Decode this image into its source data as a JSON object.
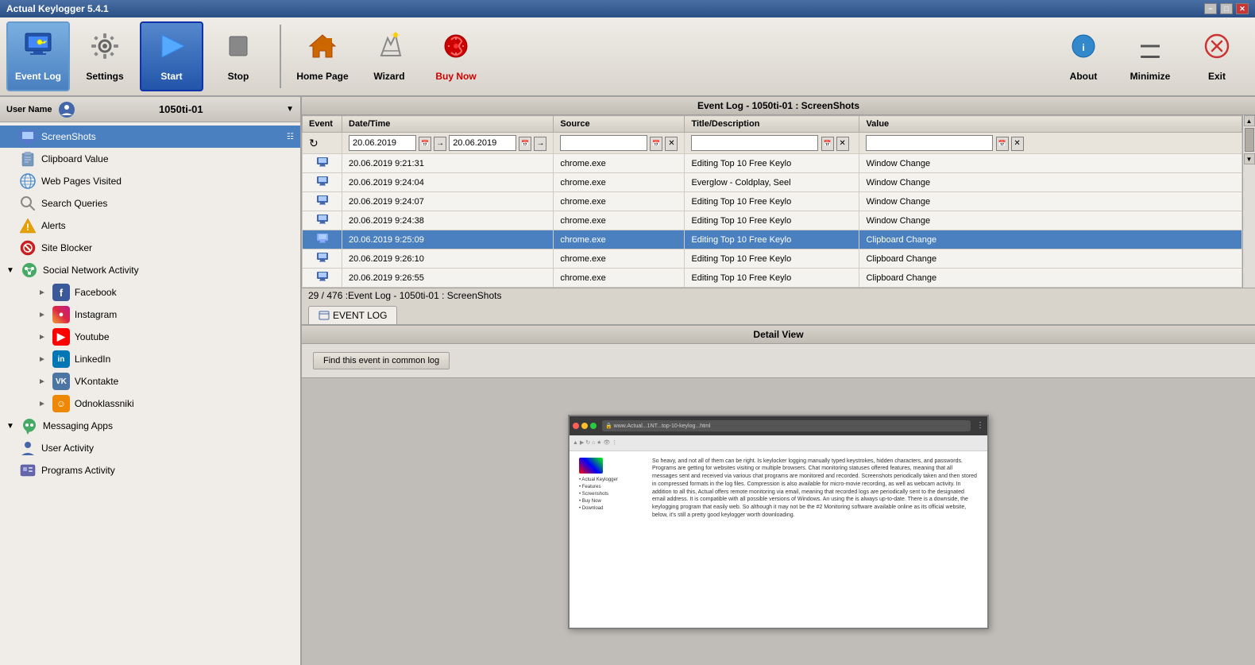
{
  "app": {
    "title": "Actual Keylogger 5.4.1",
    "title_buttons": [
      "minimize",
      "maximize",
      "close"
    ]
  },
  "toolbar": {
    "event_log_label": "Event Log",
    "settings_label": "Settings",
    "start_label": "Start",
    "stop_label": "Stop",
    "home_page_label": "Home Page",
    "wizard_label": "Wizard",
    "buy_now_label": "Buy Now",
    "about_label": "About",
    "minimize_label": "Minimize",
    "exit_label": "Exit"
  },
  "sidebar": {
    "user_label": "User Name",
    "username": "1050ti-01",
    "items": [
      {
        "id": "screenshots",
        "label": "ScreenShots",
        "indent": 1,
        "icon": "monitor",
        "selected": true
      },
      {
        "id": "clipboard",
        "label": "Clipboard Value",
        "indent": 1,
        "icon": "clipboard",
        "selected": false
      },
      {
        "id": "web-pages",
        "label": "Web Pages Visited",
        "indent": 1,
        "icon": "globe",
        "selected": false
      },
      {
        "id": "search",
        "label": "Search Queries",
        "indent": 1,
        "icon": "search",
        "selected": false
      },
      {
        "id": "alerts",
        "label": "Alerts",
        "indent": 1,
        "icon": "alert",
        "selected": false
      },
      {
        "id": "site-blocker",
        "label": "Site Blocker",
        "indent": 1,
        "icon": "block",
        "selected": false
      },
      {
        "id": "social",
        "label": "Social Network Activity",
        "indent": 0,
        "icon": "social",
        "selected": false,
        "expandable": true
      },
      {
        "id": "facebook",
        "label": "Facebook",
        "indent": 2,
        "icon": "fb",
        "selected": false,
        "expandable": true
      },
      {
        "id": "instagram",
        "label": "Instagram",
        "indent": 2,
        "icon": "ig",
        "selected": false,
        "expandable": true
      },
      {
        "id": "youtube",
        "label": "Youtube",
        "indent": 2,
        "icon": "yt",
        "selected": false,
        "expandable": true
      },
      {
        "id": "linkedin",
        "label": "LinkedIn",
        "indent": 2,
        "icon": "li",
        "selected": false,
        "expandable": true
      },
      {
        "id": "vkontakte",
        "label": "VKontakte",
        "indent": 2,
        "icon": "vk",
        "selected": false,
        "expandable": true
      },
      {
        "id": "odnoklassniki",
        "label": "Odnoklassniki",
        "indent": 2,
        "icon": "ok",
        "selected": false,
        "expandable": true
      },
      {
        "id": "messaging",
        "label": "Messaging Apps",
        "indent": 0,
        "icon": "messaging",
        "selected": false,
        "expandable": true
      },
      {
        "id": "user-activity",
        "label": "User Activity",
        "indent": 1,
        "icon": "user",
        "selected": false
      },
      {
        "id": "programs",
        "label": "Programs Activity",
        "indent": 1,
        "icon": "programs",
        "selected": false
      }
    ]
  },
  "event_log": {
    "panel_title": "Event Log - 1050ti-01 : ScreenShots",
    "columns": [
      "Event",
      "Date/Time",
      "Source",
      "Title/Description",
      "Value"
    ],
    "date_from": "20.06.2019",
    "date_to": "20.06.2019",
    "rows": [
      {
        "icon": "monitor",
        "datetime": "20.06.2019 9:21:31",
        "source": "chrome.exe",
        "title": "Editing Top 10 Free Keylo",
        "value": "Window Change",
        "selected": false
      },
      {
        "icon": "monitor",
        "datetime": "20.06.2019 9:24:04",
        "source": "chrome.exe",
        "title": "Everglow - Coldplay, Seel",
        "value": "Window Change",
        "selected": false
      },
      {
        "icon": "monitor",
        "datetime": "20.06.2019 9:24:07",
        "source": "chrome.exe",
        "title": "Editing Top 10 Free Keylo",
        "value": "Window Change",
        "selected": false
      },
      {
        "icon": "monitor",
        "datetime": "20.06.2019 9:24:38",
        "source": "chrome.exe",
        "title": "Editing Top 10 Free Keylo",
        "value": "Window Change",
        "selected": false
      },
      {
        "icon": "monitor",
        "datetime": "20.06.2019 9:25:09",
        "source": "chrome.exe",
        "title": "Editing Top 10 Free Keylo",
        "value": "Clipboard Change",
        "selected": true
      },
      {
        "icon": "monitor",
        "datetime": "20.06.2019 9:26:10",
        "source": "chrome.exe",
        "title": "Editing Top 10 Free Keylo",
        "value": "Clipboard Change",
        "selected": false
      },
      {
        "icon": "monitor",
        "datetime": "20.06.2019 9:26:55",
        "source": "chrome.exe",
        "title": "Editing Top 10 Free Keylo",
        "value": "Clipboard Change",
        "selected": false
      }
    ],
    "status": "29 / 476  :Event Log - 1050ti-01 : ScreenShots",
    "tab_label": "EVENT LOG"
  },
  "detail_view": {
    "title": "Detail View",
    "find_button": "Find this event in common log",
    "screenshot_text_left": "So heavy, and not all of them can be right. Is keylocker logging manually typed keystrokes, hidden characters, and passwords. Programs are getting for websites visiting or multiple browsers. Chat monitoring statuses offered features, meaning that all messages sent and received via various chat programs are monitored and recorded. Screenshots periodically taken and then stored in compressed formats in the log files. Compression is also available for micro-movie recording, as well as webcam activity. In addition to all this, Actual offers remote monitoring via email, meaning that recorded logs are periodically sent to the designated email address. It is compatible with all possible versions of Windows. An using the is always up-to-date. There is a downside, the keylogging program that easily web. So although it may not be the #2 Monitoring software available online as its official website, below, it's still a pretty good keylogger worth downloading."
  }
}
